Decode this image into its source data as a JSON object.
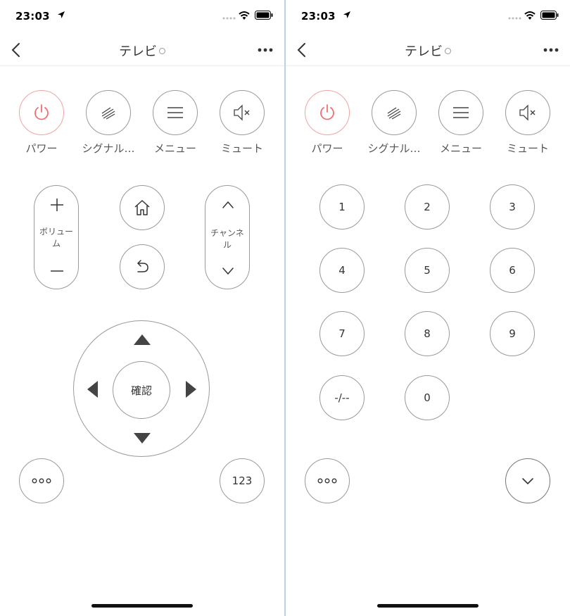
{
  "status_bar": {
    "time": "23:03"
  },
  "nav": {
    "title": "テレビ"
  },
  "top_buttons": [
    {
      "label": "パワー",
      "icon": "power-icon"
    },
    {
      "label": "シグナル…",
      "icon": "signal-icon"
    },
    {
      "label": "メニュー",
      "icon": "menu-icon"
    },
    {
      "label": "ミュート",
      "icon": "mute-icon"
    }
  ],
  "remote": {
    "volume_label": "ボリューム",
    "channel_label": "チャンネル",
    "confirm_label": "確認",
    "numpad_toggle_label": "123"
  },
  "numpad": {
    "keys": [
      "1",
      "2",
      "3",
      "4",
      "5",
      "6",
      "7",
      "8",
      "9",
      "-/--",
      "0"
    ]
  },
  "colors": {
    "accent": "#f06f6f",
    "border": "#9a9a9a",
    "divider": "#b9d3e6"
  }
}
